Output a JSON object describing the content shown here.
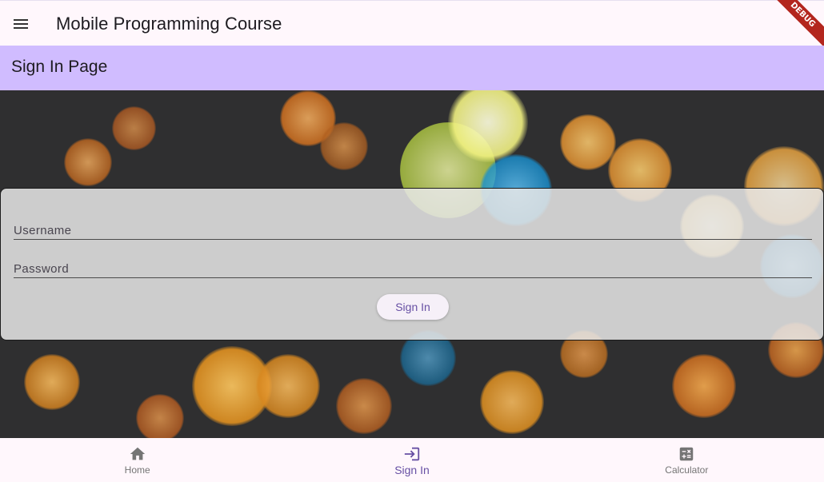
{
  "appbar": {
    "title": "Mobile Programming Course",
    "menu_icon": "menu-icon",
    "debug_label": "DEBUG"
  },
  "page": {
    "title": "Sign In Page"
  },
  "form": {
    "username_placeholder": "Username",
    "username_value": "",
    "password_placeholder": "Password",
    "password_value": "",
    "submit_label": "Sign In"
  },
  "bottom_nav": {
    "items": [
      {
        "label": "Home",
        "icon": "home-icon",
        "active": false
      },
      {
        "label": "Sign In",
        "icon": "login-icon",
        "active": true
      },
      {
        "label": "Calculator",
        "icon": "calculator-icon",
        "active": false
      }
    ]
  },
  "colors": {
    "accent": "#6750a4",
    "subbar": "#d0bcff",
    "surface": "#fff7fc",
    "debug_banner": "#b3261e"
  }
}
